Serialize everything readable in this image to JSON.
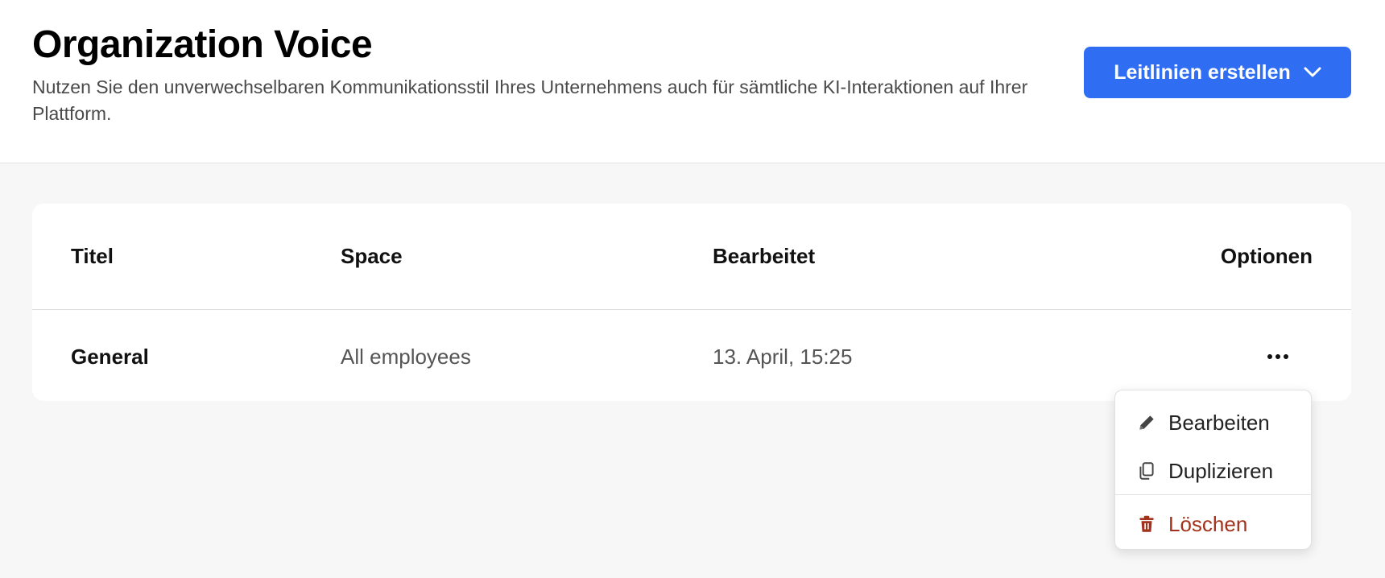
{
  "header": {
    "title": "Organization Voice",
    "subtitle": "Nutzen Sie den unverwechselbaren Kommunikationsstil Ihres Unternehmens auch für sämtliche KI-Interaktionen auf Ihrer Plattform.",
    "create_button_label": "Leitlinien erstellen",
    "create_button_icon": "chevron-down-icon",
    "accent_color": "#2f6ef2"
  },
  "table": {
    "columns": [
      "Titel",
      "Space",
      "Bearbeitet",
      "Optionen"
    ],
    "rows": [
      {
        "title": "General",
        "space": "All employees",
        "edited": "13. April, 15:25",
        "options_icon": "more-horizontal-icon"
      }
    ]
  },
  "options_menu": {
    "items": [
      {
        "label": "Bearbeiten",
        "icon": "pencil-icon"
      },
      {
        "label": "Duplizieren",
        "icon": "copy-icon"
      },
      {
        "label": "Löschen",
        "icon": "trash-icon",
        "color": "#a3321c"
      }
    ]
  }
}
